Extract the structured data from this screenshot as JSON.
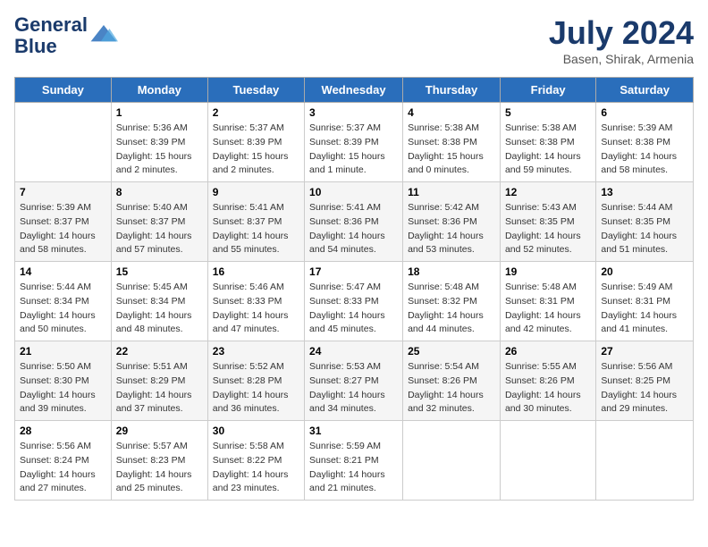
{
  "header": {
    "logo_line1": "General",
    "logo_line2": "Blue",
    "month": "July 2024",
    "location": "Basen, Shirak, Armenia"
  },
  "weekdays": [
    "Sunday",
    "Monday",
    "Tuesday",
    "Wednesday",
    "Thursday",
    "Friday",
    "Saturday"
  ],
  "weeks": [
    [
      {
        "num": "",
        "detail": ""
      },
      {
        "num": "1",
        "detail": "Sunrise: 5:36 AM\nSunset: 8:39 PM\nDaylight: 15 hours\nand 2 minutes."
      },
      {
        "num": "2",
        "detail": "Sunrise: 5:37 AM\nSunset: 8:39 PM\nDaylight: 15 hours\nand 2 minutes."
      },
      {
        "num": "3",
        "detail": "Sunrise: 5:37 AM\nSunset: 8:39 PM\nDaylight: 15 hours\nand 1 minute."
      },
      {
        "num": "4",
        "detail": "Sunrise: 5:38 AM\nSunset: 8:38 PM\nDaylight: 15 hours\nand 0 minutes."
      },
      {
        "num": "5",
        "detail": "Sunrise: 5:38 AM\nSunset: 8:38 PM\nDaylight: 14 hours\nand 59 minutes."
      },
      {
        "num": "6",
        "detail": "Sunrise: 5:39 AM\nSunset: 8:38 PM\nDaylight: 14 hours\nand 58 minutes."
      }
    ],
    [
      {
        "num": "7",
        "detail": "Sunrise: 5:39 AM\nSunset: 8:37 PM\nDaylight: 14 hours\nand 58 minutes."
      },
      {
        "num": "8",
        "detail": "Sunrise: 5:40 AM\nSunset: 8:37 PM\nDaylight: 14 hours\nand 57 minutes."
      },
      {
        "num": "9",
        "detail": "Sunrise: 5:41 AM\nSunset: 8:37 PM\nDaylight: 14 hours\nand 55 minutes."
      },
      {
        "num": "10",
        "detail": "Sunrise: 5:41 AM\nSunset: 8:36 PM\nDaylight: 14 hours\nand 54 minutes."
      },
      {
        "num": "11",
        "detail": "Sunrise: 5:42 AM\nSunset: 8:36 PM\nDaylight: 14 hours\nand 53 minutes."
      },
      {
        "num": "12",
        "detail": "Sunrise: 5:43 AM\nSunset: 8:35 PM\nDaylight: 14 hours\nand 52 minutes."
      },
      {
        "num": "13",
        "detail": "Sunrise: 5:44 AM\nSunset: 8:35 PM\nDaylight: 14 hours\nand 51 minutes."
      }
    ],
    [
      {
        "num": "14",
        "detail": "Sunrise: 5:44 AM\nSunset: 8:34 PM\nDaylight: 14 hours\nand 50 minutes."
      },
      {
        "num": "15",
        "detail": "Sunrise: 5:45 AM\nSunset: 8:34 PM\nDaylight: 14 hours\nand 48 minutes."
      },
      {
        "num": "16",
        "detail": "Sunrise: 5:46 AM\nSunset: 8:33 PM\nDaylight: 14 hours\nand 47 minutes."
      },
      {
        "num": "17",
        "detail": "Sunrise: 5:47 AM\nSunset: 8:33 PM\nDaylight: 14 hours\nand 45 minutes."
      },
      {
        "num": "18",
        "detail": "Sunrise: 5:48 AM\nSunset: 8:32 PM\nDaylight: 14 hours\nand 44 minutes."
      },
      {
        "num": "19",
        "detail": "Sunrise: 5:48 AM\nSunset: 8:31 PM\nDaylight: 14 hours\nand 42 minutes."
      },
      {
        "num": "20",
        "detail": "Sunrise: 5:49 AM\nSunset: 8:31 PM\nDaylight: 14 hours\nand 41 minutes."
      }
    ],
    [
      {
        "num": "21",
        "detail": "Sunrise: 5:50 AM\nSunset: 8:30 PM\nDaylight: 14 hours\nand 39 minutes."
      },
      {
        "num": "22",
        "detail": "Sunrise: 5:51 AM\nSunset: 8:29 PM\nDaylight: 14 hours\nand 37 minutes."
      },
      {
        "num": "23",
        "detail": "Sunrise: 5:52 AM\nSunset: 8:28 PM\nDaylight: 14 hours\nand 36 minutes."
      },
      {
        "num": "24",
        "detail": "Sunrise: 5:53 AM\nSunset: 8:27 PM\nDaylight: 14 hours\nand 34 minutes."
      },
      {
        "num": "25",
        "detail": "Sunrise: 5:54 AM\nSunset: 8:26 PM\nDaylight: 14 hours\nand 32 minutes."
      },
      {
        "num": "26",
        "detail": "Sunrise: 5:55 AM\nSunset: 8:26 PM\nDaylight: 14 hours\nand 30 minutes."
      },
      {
        "num": "27",
        "detail": "Sunrise: 5:56 AM\nSunset: 8:25 PM\nDaylight: 14 hours\nand 29 minutes."
      }
    ],
    [
      {
        "num": "28",
        "detail": "Sunrise: 5:56 AM\nSunset: 8:24 PM\nDaylight: 14 hours\nand 27 minutes."
      },
      {
        "num": "29",
        "detail": "Sunrise: 5:57 AM\nSunset: 8:23 PM\nDaylight: 14 hours\nand 25 minutes."
      },
      {
        "num": "30",
        "detail": "Sunrise: 5:58 AM\nSunset: 8:22 PM\nDaylight: 14 hours\nand 23 minutes."
      },
      {
        "num": "31",
        "detail": "Sunrise: 5:59 AM\nSunset: 8:21 PM\nDaylight: 14 hours\nand 21 minutes."
      },
      {
        "num": "",
        "detail": ""
      },
      {
        "num": "",
        "detail": ""
      },
      {
        "num": "",
        "detail": ""
      }
    ]
  ]
}
